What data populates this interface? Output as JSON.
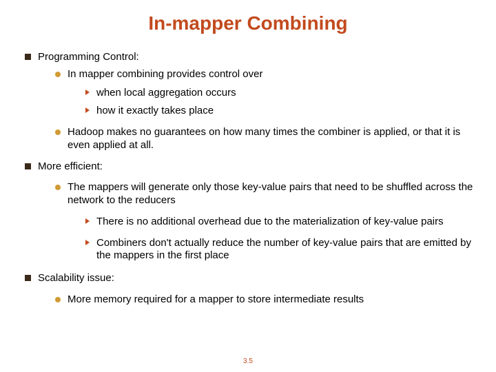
{
  "title": "In-mapper Combining",
  "sections": [
    {
      "heading": "Programming Control:",
      "subs": [
        {
          "text": "In mapper combining provides control over",
          "points": [
            "when local aggregation occurs",
            "how it exactly takes place"
          ]
        },
        {
          "text": "Hadoop makes no guarantees on how many times the combiner is applied, or that it is even applied at all.",
          "points": []
        }
      ]
    },
    {
      "heading": "More efficient:",
      "subs": [
        {
          "text": "The mappers will generate only those key-value pairs that need to be shuffled across the network to the reducers",
          "points": [
            "There is no additional overhead due to the materialization of key-value pairs",
            "Combiners don't actually reduce the number of key-value pairs that are emitted by the mappers in the first place"
          ]
        }
      ]
    },
    {
      "heading": "Scalability issue:",
      "subs": [
        {
          "text": "More memory required for a mapper to store intermediate results",
          "points": []
        }
      ]
    }
  ],
  "page_number": "3.5"
}
